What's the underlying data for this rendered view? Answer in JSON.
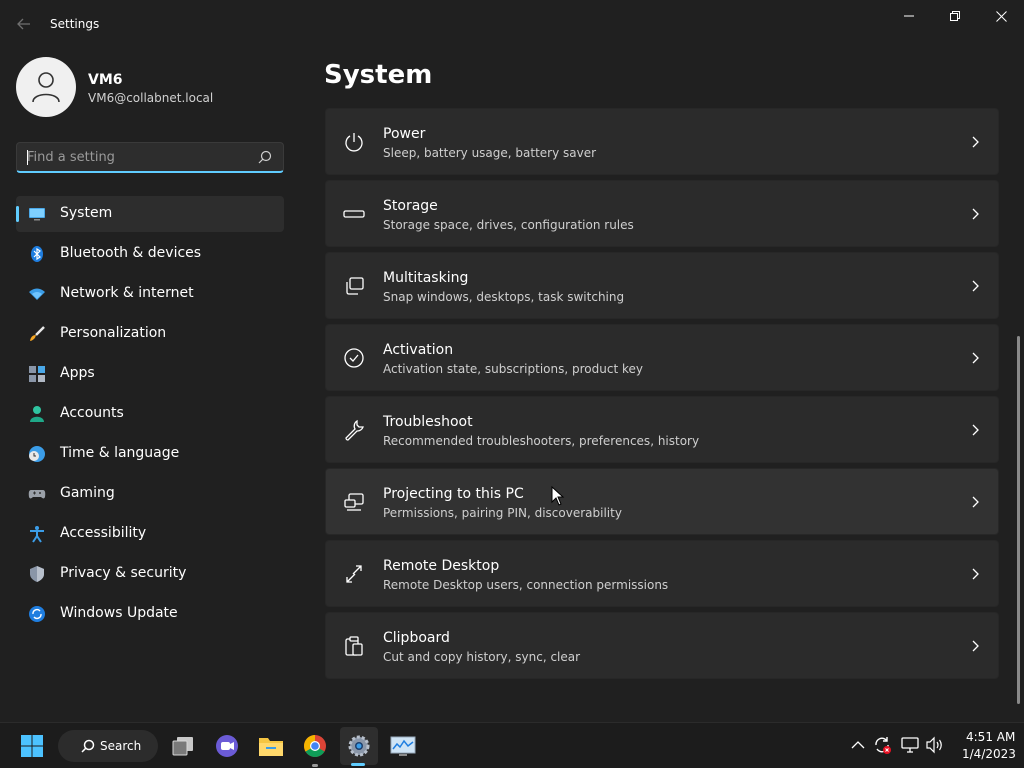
{
  "window": {
    "title": "Settings",
    "back_icon": "back-arrow-icon",
    "controls": {
      "minimize": "—",
      "maximize": "❐",
      "close": "✕"
    }
  },
  "profile": {
    "name": "VM6",
    "email": "VM6@collabnet.local"
  },
  "search": {
    "placeholder": "Find a setting",
    "value": ""
  },
  "sidebar": {
    "items": [
      {
        "label": "System",
        "icon": "monitor-icon",
        "active": true
      },
      {
        "label": "Bluetooth & devices",
        "icon": "bluetooth-icon"
      },
      {
        "label": "Network & internet",
        "icon": "wifi-icon"
      },
      {
        "label": "Personalization",
        "icon": "brush-icon"
      },
      {
        "label": "Apps",
        "icon": "apps-icon"
      },
      {
        "label": "Accounts",
        "icon": "person-icon"
      },
      {
        "label": "Time & language",
        "icon": "globe-clock-icon"
      },
      {
        "label": "Gaming",
        "icon": "gamepad-icon"
      },
      {
        "label": "Accessibility",
        "icon": "accessibility-icon"
      },
      {
        "label": "Privacy & security",
        "icon": "shield-icon"
      },
      {
        "label": "Windows Update",
        "icon": "update-icon"
      }
    ]
  },
  "main": {
    "title": "System",
    "cards": [
      {
        "title": "Power",
        "subtitle": "Sleep, battery usage, battery saver",
        "icon": "power-icon"
      },
      {
        "title": "Storage",
        "subtitle": "Storage space, drives, configuration rules",
        "icon": "storage-icon"
      },
      {
        "title": "Multitasking",
        "subtitle": "Snap windows, desktops, task switching",
        "icon": "multitasking-icon"
      },
      {
        "title": "Activation",
        "subtitle": "Activation state, subscriptions, product key",
        "icon": "check-circle-icon"
      },
      {
        "title": "Troubleshoot",
        "subtitle": "Recommended troubleshooters, preferences, history",
        "icon": "wrench-icon"
      },
      {
        "title": "Projecting to this PC",
        "subtitle": "Permissions, pairing PIN, discoverability",
        "icon": "projecting-icon"
      },
      {
        "title": "Remote Desktop",
        "subtitle": "Remote Desktop users, connection permissions",
        "icon": "remote-desktop-icon"
      },
      {
        "title": "Clipboard",
        "subtitle": "Cut and copy history, sync, clear",
        "icon": "clipboard-icon"
      }
    ]
  },
  "taskbar": {
    "search_label": "Search",
    "clock_time": "4:51 AM",
    "clock_date": "1/4/2023",
    "apps": [
      "start-icon",
      "task-view-icon",
      "chat-icon",
      "file-explorer-icon",
      "chrome-icon",
      "settings-icon",
      "resource-monitor-icon"
    ],
    "tray": [
      "chevron-up-icon",
      "sync-error-icon",
      "network-icon",
      "volume-icon"
    ]
  },
  "colors": {
    "accent": "#60cdff",
    "background": "#202020",
    "card": "#2b2b2b",
    "taskbar": "#1c1c1c"
  }
}
